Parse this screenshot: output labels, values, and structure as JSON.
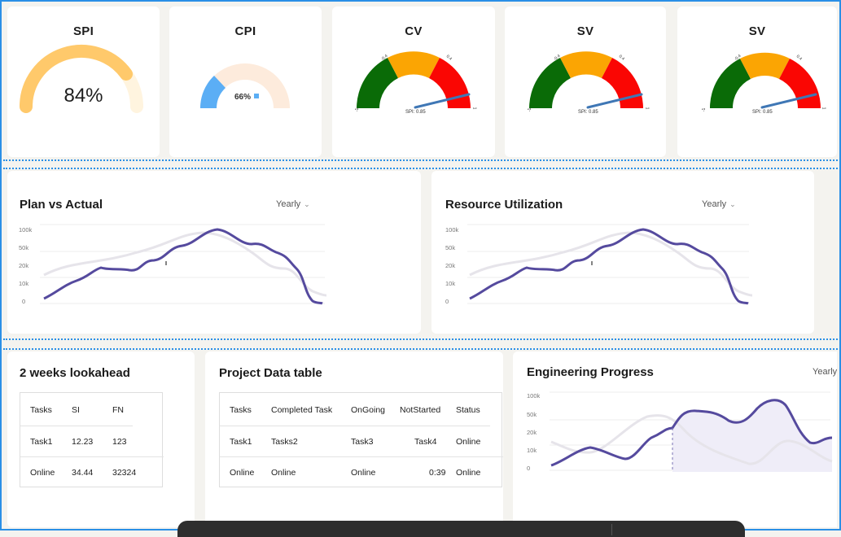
{
  "kpis": {
    "spi": {
      "title": "SPI",
      "value": "84%",
      "progress": 0.84,
      "color": "#ffc96b",
      "track": "#fff4df"
    },
    "cpi": {
      "title": "CPI",
      "value": "66%",
      "progress": 0.34,
      "color": "#5baef5",
      "track": "#fdebdc"
    },
    "cv": {
      "title": "CV",
      "needle_label": "SPI: 0.85",
      "tick_left": "-0.4",
      "tick_right": "0.4",
      "min_label": "-1",
      "max_label": "1"
    },
    "sv1": {
      "title": "SV",
      "needle_label": "SPI: 0.85",
      "tick_left": "-0.4",
      "tick_right": "0.4",
      "min_label": "-1",
      "max_label": "1"
    },
    "sv2": {
      "title": "SV",
      "needle_label": "SPI: 0.85",
      "tick_left": "-0.4",
      "tick_right": "0.4",
      "min_label": "-1",
      "max_label": "1"
    },
    "gauge_colors": {
      "low": "#0a6b07",
      "mid": "#fba503",
      "high": "#fa0603",
      "needle": "#3f77b5"
    }
  },
  "plan_vs_actual": {
    "title": "Plan vs Actual",
    "period": "Yearly"
  },
  "resource_utilization": {
    "title": "Resource Utilization",
    "period": "Yearly"
  },
  "engineering_progress": {
    "title": "Engineering Progress",
    "period": "Yearly"
  },
  "y_ticks": [
    "100k",
    "50k",
    "20k",
    "10k",
    "0"
  ],
  "colors": {
    "actual": "#554a9e",
    "plan": "#e6e4ea",
    "frame": "#2a8fe6"
  },
  "lookahead": {
    "title": "2 weeks lookahead",
    "headers": [
      "Tasks",
      "SI",
      "FN"
    ],
    "rows": [
      [
        "Task1",
        "12.23",
        "123"
      ],
      [
        "Online",
        "34.44",
        "32324"
      ]
    ]
  },
  "project_table": {
    "title": "Project Data table",
    "headers": [
      "Tasks",
      "Completed Task",
      "OnGoing",
      "NotStarted",
      "Status"
    ],
    "rows": [
      [
        "Task1",
        "Tasks2",
        "Task3",
        "Task4",
        "Online"
      ],
      [
        "Online",
        "Online",
        "Online",
        "0:39",
        "Online"
      ]
    ]
  }
}
